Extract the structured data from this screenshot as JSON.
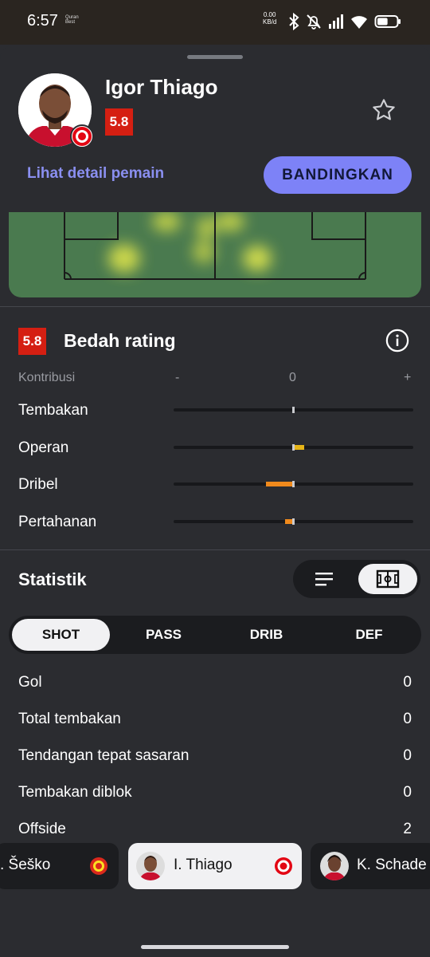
{
  "status_bar": {
    "time": "6:57",
    "app_line1": "Quran",
    "app_line2": "Best",
    "net_speed_value": "0.00",
    "net_speed_unit": "KB/d",
    "battery_level": 0.55,
    "icons": [
      "bluetooth-icon",
      "mute-icon",
      "signal-icon",
      "wifi-icon",
      "battery-icon"
    ]
  },
  "player": {
    "name": "Igor Thiago",
    "rating": "5.8",
    "detail_link": "Lihat detail pemain",
    "compare_button": "BANDINGKAN"
  },
  "rating_breakdown": {
    "rating": "5.8",
    "title": "Bedah rating",
    "contribution_label": "Kontribusi",
    "scale_minus": "-",
    "scale_zero": "0",
    "scale_plus": "+",
    "bars": [
      {
        "label": "Tembakan",
        "value": 0.0,
        "color": "#e6a817"
      },
      {
        "label": "Operan",
        "value": 0.08,
        "color": "#e6b417"
      },
      {
        "label": "Dribel",
        "value": -0.22,
        "color": "#f08a1c"
      },
      {
        "label": "Pertahanan",
        "value": -0.06,
        "color": "#f08a1c"
      }
    ]
  },
  "stats": {
    "title": "Statistik",
    "tabs": [
      {
        "label": "SHOT",
        "active": true
      },
      {
        "label": "PASS",
        "active": false
      },
      {
        "label": "DRIB",
        "active": false
      },
      {
        "label": "DEF",
        "active": false
      }
    ],
    "rows": [
      {
        "label": "Gol",
        "value": "0"
      },
      {
        "label": "Total tembakan",
        "value": "0"
      },
      {
        "label": "Tendangan tepat sasaran",
        "value": "0"
      },
      {
        "label": "Tembakan diblok",
        "value": "0"
      },
      {
        "label": "Offside",
        "value": "2"
      }
    ]
  },
  "carousel": [
    {
      "name": ". Šeško",
      "club": "Manchester United"
    },
    {
      "name": "I. Thiago",
      "club": "Brentford",
      "active": true
    },
    {
      "name": "K. Schade",
      "club": "Brentford"
    }
  ],
  "colors": {
    "accent": "#7d82f7",
    "rating_red": "#d51f12",
    "pitch_green": "#4a7a4f",
    "background": "#2b2c30"
  }
}
